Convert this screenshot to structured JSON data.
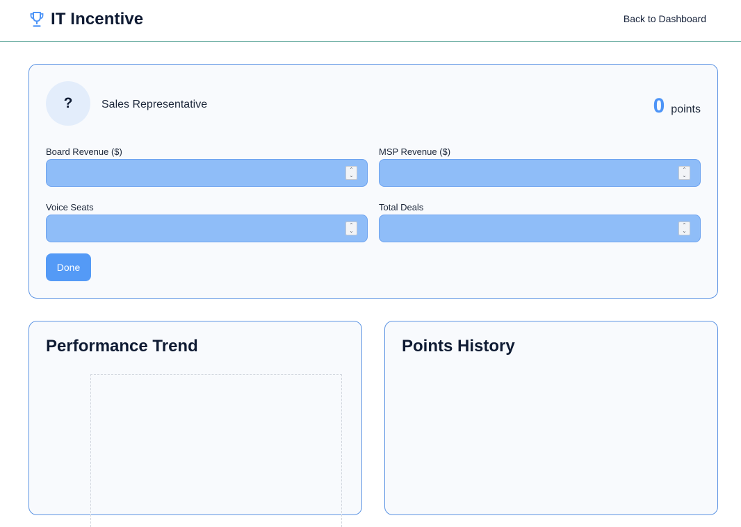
{
  "header": {
    "app_title": "IT Incentive",
    "brand_icon": "trophy-icon",
    "back_link": "Back to Dashboard"
  },
  "profile": {
    "avatar_text": "?",
    "role": "Sales Representative",
    "points_value": "0",
    "points_label": "points"
  },
  "form": {
    "fields": [
      {
        "label": "Board Revenue ($)",
        "value": ""
      },
      {
        "label": "MSP Revenue ($)",
        "value": ""
      },
      {
        "label": "Voice Seats",
        "value": ""
      },
      {
        "label": "Total Deals",
        "value": ""
      }
    ],
    "done_label": "Done"
  },
  "panels": {
    "trend_title": "Performance Trend",
    "history_title": "Points History"
  },
  "colors": {
    "accent": "#4d94f7",
    "input_fill": "#8fbdf8",
    "card_border": "#5b93e3",
    "header_rule": "#5fa79b"
  }
}
